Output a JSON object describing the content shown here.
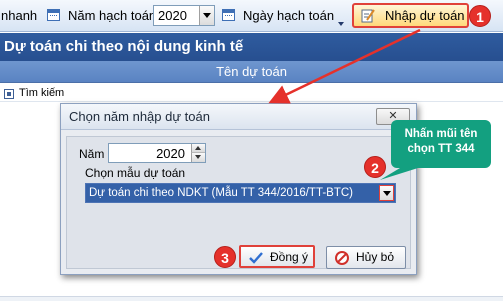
{
  "toolbar": {
    "nhanh_label": "nhanh",
    "nam_hach_toan_label": "Năm hạch toán",
    "year_value": "2020",
    "ngay_hach_toan_label": "Ngày hạch toán",
    "nhap_du_toan_label": "Nhập dự toán"
  },
  "main": {
    "title": "Dự toán chi theo nội dung kinh tế",
    "column_header": "Tên dự toán",
    "search_label": "Tìm kiếm"
  },
  "dialog": {
    "title": "Chọn năm nhập dự toán",
    "close_symbol": "✕",
    "nam_label": "Năm",
    "nam_value": "2020",
    "mau_label": "Chọn mẫu dự toán",
    "mau_value": "Dự toán chi theo NDKT (Mẫu TT 344/2016/TT-BTC)",
    "ok_label": "Đồng ý",
    "cancel_label": "Hủy bỏ"
  },
  "annotations": {
    "step1": "1",
    "step2": "2",
    "step3": "3",
    "tip_line1": "Nhấn mũi tên",
    "tip_line2": "chọn TT 344"
  },
  "colors": {
    "title_bar": "#2f5c9f",
    "highlight_red": "#e0413a",
    "tip_green": "#13a080",
    "selected_blue": "#3461a8"
  }
}
